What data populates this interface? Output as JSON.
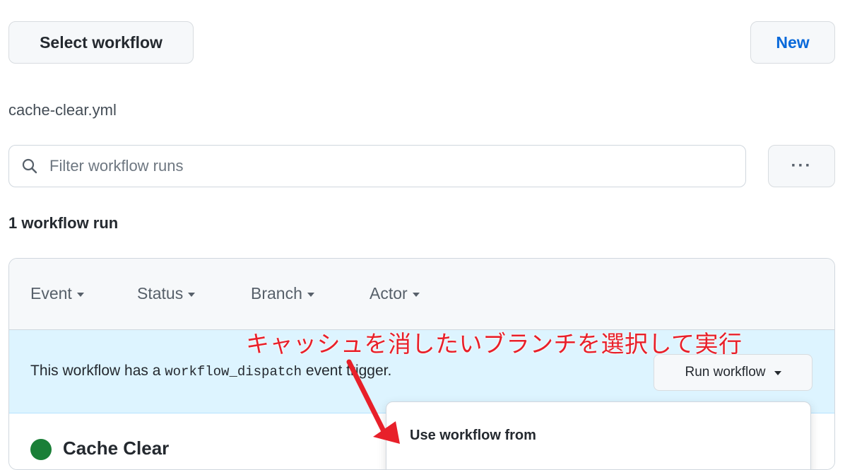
{
  "toolbar": {
    "select_workflow_label": "Select workflow",
    "new_label": "New"
  },
  "workflow": {
    "file_name": "cache-clear.yml"
  },
  "filter": {
    "placeholder": "Filter workflow runs",
    "more_label": "···"
  },
  "runs": {
    "count_label": "1 workflow run"
  },
  "filters_bar": {
    "items": [
      {
        "label": "Event"
      },
      {
        "label": "Status"
      },
      {
        "label": "Branch"
      },
      {
        "label": "Actor"
      }
    ]
  },
  "dispatch": {
    "text_before": "This workflow has a ",
    "code": "workflow_dispatch",
    "text_after": " event trigger.",
    "run_button_label": "Run workflow"
  },
  "run_item": {
    "title": "Cache Clear",
    "status_color": "#1a7f37"
  },
  "dropdown": {
    "title": "Use workflow from"
  },
  "annotation": {
    "text": "キャッシュを消したいブランチを選択して実行",
    "color": "#e8202a"
  },
  "icons": {
    "search": "search-icon",
    "caret": "caret-down-icon"
  }
}
